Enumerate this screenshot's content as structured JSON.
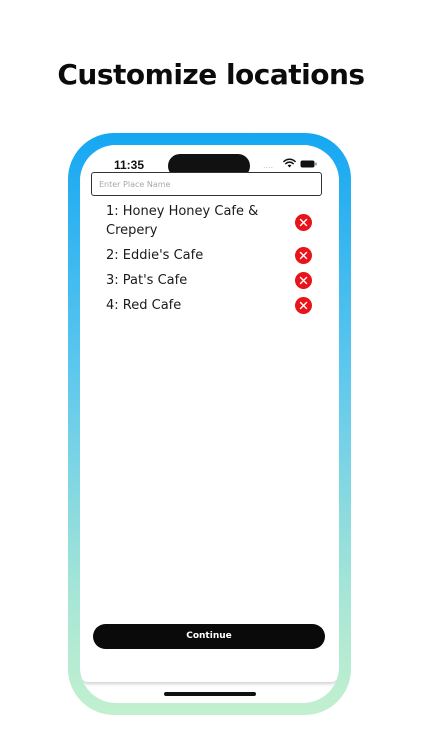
{
  "headline": "Customize locations",
  "status_bar": {
    "time": "11:35",
    "signal_dots": "....",
    "icons": [
      "wifi-icon",
      "battery-icon"
    ]
  },
  "search": {
    "placeholder": "Enter Place Name",
    "value": ""
  },
  "locations": [
    {
      "label": "1: Honey Honey Cafe & Crepery",
      "action_icon": "delete-icon"
    },
    {
      "label": "2: Eddie's Cafe",
      "action_icon": "delete-icon"
    },
    {
      "label": "3: Pat's Cafe",
      "action_icon": "delete-icon"
    },
    {
      "label": "4: Red Cafe",
      "action_icon": "delete-icon"
    }
  ],
  "continue_label": "Continue",
  "colors": {
    "frame_top": "#16a7f2",
    "frame_bottom": "#c2f0cf",
    "delete": "#e8141c",
    "button": "#0a0a0a"
  }
}
